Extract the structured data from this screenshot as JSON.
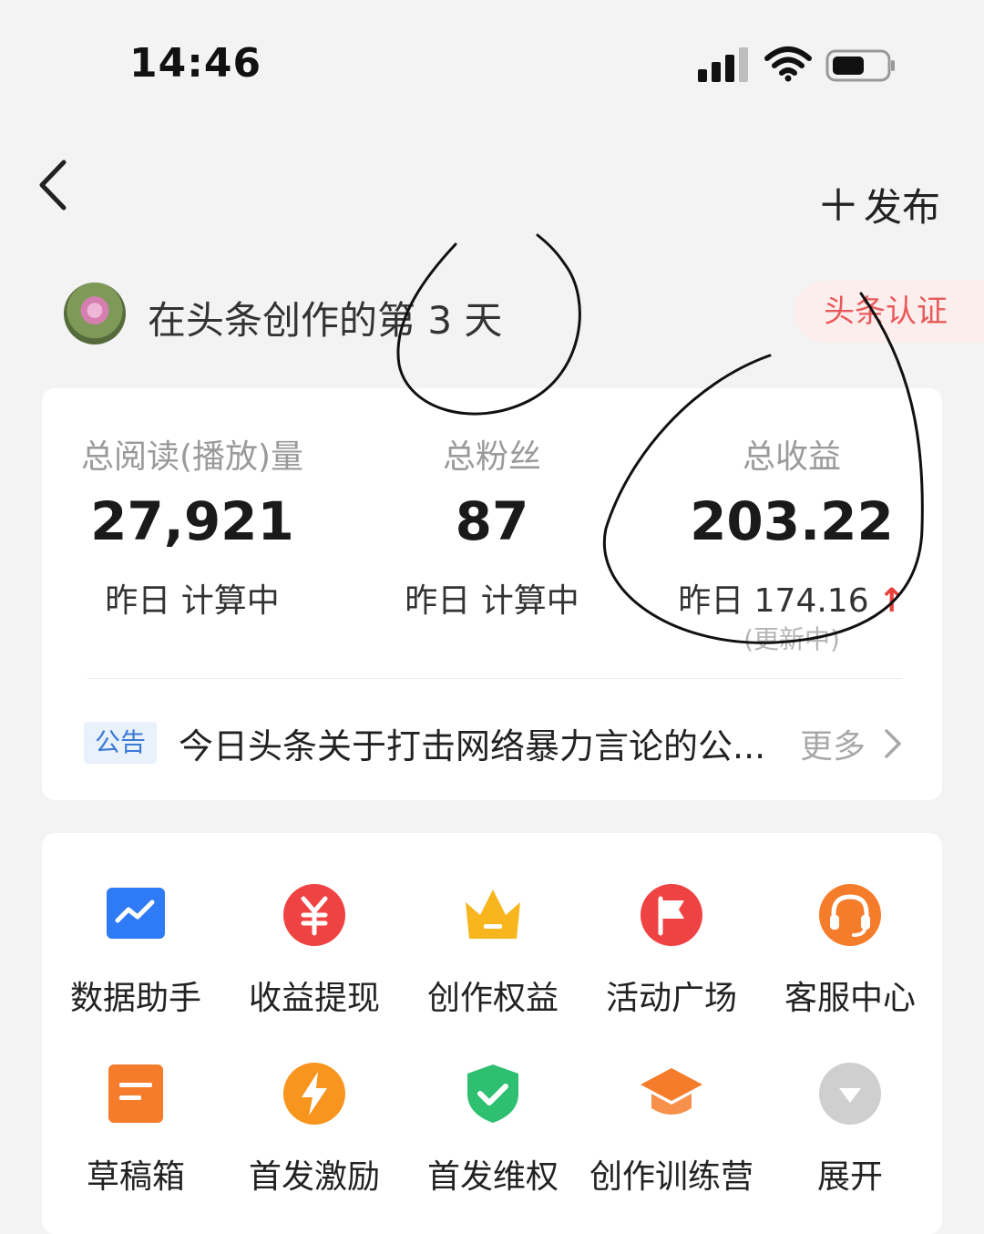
{
  "status_bar": {
    "time": "14:46"
  },
  "nav": {
    "publish_label": "发布"
  },
  "profile": {
    "days_text": "在头条创作的第 3 天",
    "cert_label": "头条认证"
  },
  "stats": [
    {
      "label": "总阅读(播放)量",
      "value": "27,921",
      "sub": "昨日 计算中"
    },
    {
      "label": "总粉丝",
      "value": "87",
      "sub": "昨日 计算中"
    },
    {
      "label": "总收益",
      "value": "203.22",
      "sub": "昨日 174.16",
      "trend": "↑",
      "note": "(更新中)"
    }
  ],
  "notice": {
    "tag": "公告",
    "text": "今日头条关于打击网络暴力言论的公...",
    "more": "更多"
  },
  "tools": [
    {
      "label": "数据助手",
      "icon": "chart-icon",
      "color": "#2f7af5"
    },
    {
      "label": "收益提现",
      "icon": "yuan-icon",
      "color": "#ef4343"
    },
    {
      "label": "创作权益",
      "icon": "crown-icon",
      "color": "#f7b51e"
    },
    {
      "label": "活动广场",
      "icon": "flag-icon",
      "color": "#ef4343"
    },
    {
      "label": "客服中心",
      "icon": "headset-icon",
      "color": "#f57c2a"
    },
    {
      "label": "草稿箱",
      "icon": "draft-icon",
      "color": "#f57c2a"
    },
    {
      "label": "首发激励",
      "icon": "lightning-icon",
      "color": "#f7951e"
    },
    {
      "label": "首发维权",
      "icon": "shield-check-icon",
      "color": "#2fbf71"
    },
    {
      "label": "创作训练营",
      "icon": "graduation-cap-icon",
      "color": "#f57c2a"
    },
    {
      "label": "展开",
      "icon": "expand-icon",
      "color": "#cfcfcf"
    }
  ]
}
